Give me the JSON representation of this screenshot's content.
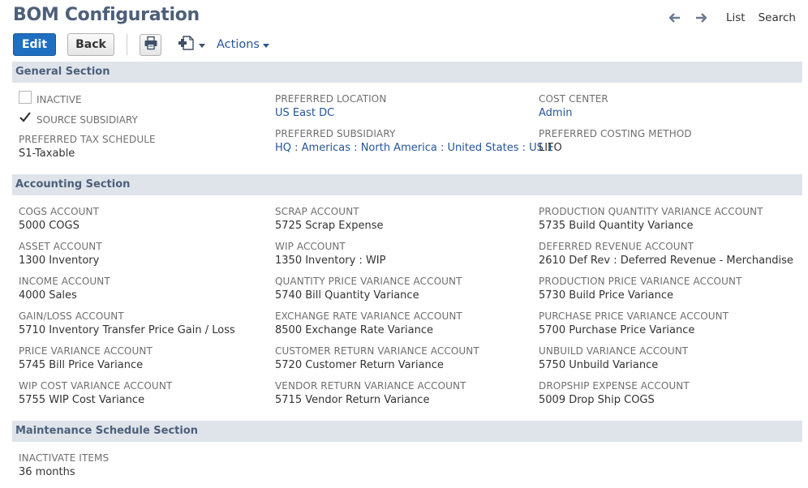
{
  "page": {
    "title": "BOM Configuration"
  },
  "nav": {
    "list": "List",
    "search": "Search"
  },
  "toolbar": {
    "edit": "Edit",
    "back": "Back",
    "actions": "Actions"
  },
  "general": {
    "title": "General Section",
    "inactive": {
      "label": "INACTIVE",
      "checked": false
    },
    "source_subsidiary": {
      "label": "SOURCE SUBSIDIARY",
      "checked": true
    },
    "preferred_tax_schedule": {
      "label": "PREFERRED TAX SCHEDULE",
      "value": "S1-Taxable"
    },
    "preferred_location": {
      "label": "PREFERRED LOCATION",
      "value": "US East DC"
    },
    "preferred_subsidiary": {
      "label": "PREFERRED SUBSIDIARY",
      "value": "HQ : Americas : North America : United States : US 1"
    },
    "cost_center": {
      "label": "COST CENTER",
      "value": "Admin"
    },
    "preferred_costing_method": {
      "label": "PREFERRED COSTING METHOD",
      "value": "LIFO"
    }
  },
  "accounting": {
    "title": "Accounting Section",
    "col1": [
      {
        "label": "COGS ACCOUNT",
        "value": "5000 COGS"
      },
      {
        "label": "ASSET ACCOUNT",
        "value": "1300 Inventory"
      },
      {
        "label": "INCOME ACCOUNT",
        "value": "4000 Sales"
      },
      {
        "label": "GAIN/LOSS ACCOUNT",
        "value": "5710 Inventory Transfer Price Gain / Loss"
      },
      {
        "label": "PRICE VARIANCE ACCOUNT",
        "value": "5745 Bill Price Variance"
      },
      {
        "label": "WIP COST VARIANCE ACCOUNT",
        "value": "5755 WIP Cost Variance"
      }
    ],
    "col2": [
      {
        "label": "SCRAP ACCOUNT",
        "value": "5725 Scrap Expense"
      },
      {
        "label": "WIP ACCOUNT",
        "value": "1350 Inventory : WIP"
      },
      {
        "label": "QUANTITY PRICE VARIANCE ACCOUNT",
        "value": "5740 Bill Quantity Variance"
      },
      {
        "label": "EXCHANGE RATE VARIANCE ACCOUNT",
        "value": "8500 Exchange Rate Variance"
      },
      {
        "label": "CUSTOMER RETURN VARIANCE ACCOUNT",
        "value": "5720 Customer Return Variance"
      },
      {
        "label": "VENDOR RETURN VARIANCE ACCOUNT",
        "value": "5715 Vendor Return Variance"
      }
    ],
    "col3": [
      {
        "label": "PRODUCTION QUANTITY VARIANCE ACCOUNT",
        "value": "5735 Build Quantity Variance"
      },
      {
        "label": "DEFERRED REVENUE ACCOUNT",
        "value": "2610 Def Rev : Deferred Revenue - Merchandise"
      },
      {
        "label": "PRODUCTION PRICE VARIANCE ACCOUNT",
        "value": "5730 Build Price Variance"
      },
      {
        "label": "PURCHASE PRICE VARIANCE ACCOUNT",
        "value": "5700 Purchase Price Variance"
      },
      {
        "label": "UNBUILD VARIANCE ACCOUNT",
        "value": "5750 Unbuild Variance"
      },
      {
        "label": "DROPSHIP EXPENSE ACCOUNT",
        "value": "5009 Drop Ship COGS"
      }
    ]
  },
  "maintenance": {
    "title": "Maintenance Schedule Section",
    "inactivate_items": {
      "label": "INACTIVATE ITEMS",
      "value": "36 months"
    }
  },
  "colors": {
    "primary": "#1f6fc0",
    "link": "#255599",
    "section_bg": "#dfe4eb",
    "title": "#4d5f79"
  }
}
